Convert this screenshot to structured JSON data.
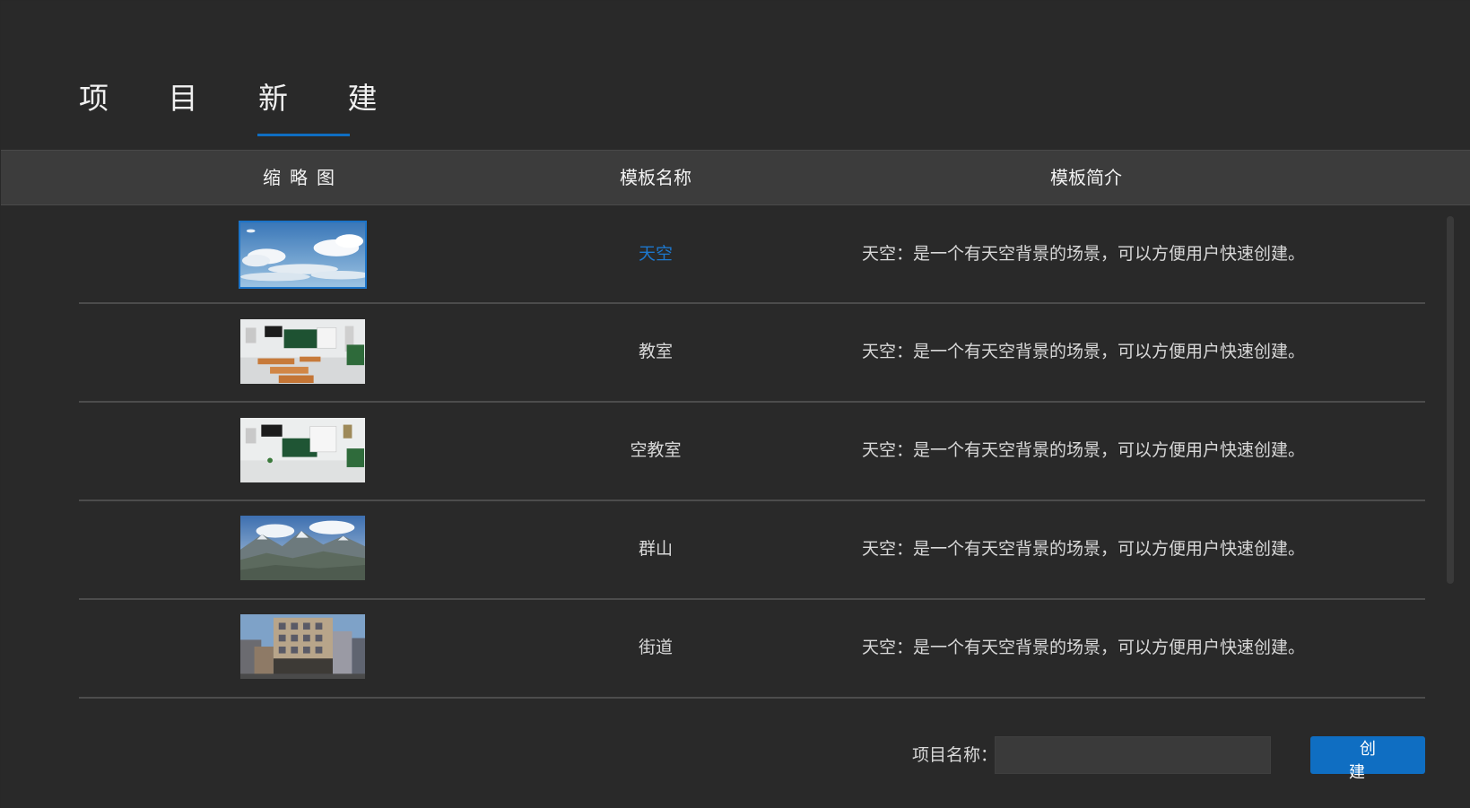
{
  "tabs": {
    "projects": "项 目",
    "new": "新 建"
  },
  "table": {
    "headers": {
      "thumbnail": "缩略图",
      "name": "模板名称",
      "description": "模板简介"
    },
    "rows": [
      {
        "name": "天空",
        "description": "天空：是一个有天空背景的场景，可以方便用户快速创建。",
        "thumbnail": "sky",
        "selected": true
      },
      {
        "name": "教室",
        "description": "天空：是一个有天空背景的场景，可以方便用户快速创建。",
        "thumbnail": "classroom",
        "selected": false
      },
      {
        "name": "空教室",
        "description": "天空：是一个有天空背景的场景，可以方便用户快速创建。",
        "thumbnail": "empty-classroom",
        "selected": false
      },
      {
        "name": "群山",
        "description": "天空：是一个有天空背景的场景，可以方便用户快速创建。",
        "thumbnail": "mountains",
        "selected": false
      },
      {
        "name": "街道",
        "description": "天空：是一个有天空背景的场景，可以方便用户快速创建。",
        "thumbnail": "street",
        "selected": false
      }
    ]
  },
  "footer": {
    "name_label": "项目名称：",
    "name_value": "",
    "create_label": "创 建"
  },
  "colors": {
    "accent": "#0f6ec2",
    "selected_text": "#1d77cc",
    "background": "#292929",
    "header_bg": "#3c3c3c"
  }
}
